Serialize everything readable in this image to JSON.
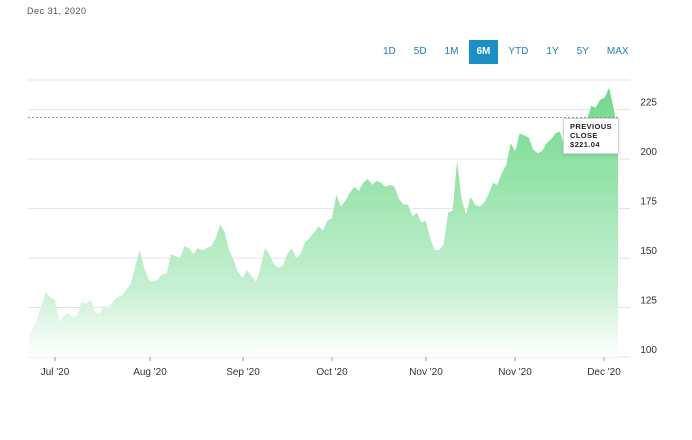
{
  "header": {
    "date": "Dec 31, 2020"
  },
  "range_tabs": [
    {
      "label": "1D",
      "active": false
    },
    {
      "label": "5D",
      "active": false
    },
    {
      "label": "1M",
      "active": false
    },
    {
      "label": "6M",
      "active": true
    },
    {
      "label": "YTD",
      "active": false
    },
    {
      "label": "1Y",
      "active": false
    },
    {
      "label": "5Y",
      "active": false
    },
    {
      "label": "MAX",
      "active": false
    }
  ],
  "tooltip": {
    "line1": "PREVIOUS",
    "line2": "CLOSE",
    "value": "$221.04"
  },
  "colors": {
    "area_top": "#6fd98a",
    "area_bottom": "#ffffff",
    "accent": "#1b8fc3",
    "grid": "#e3e3e3"
  },
  "chart_data": {
    "type": "area",
    "title": "",
    "xlabel": "",
    "ylabel": "",
    "ylim": [
      100,
      240
    ],
    "yticks": [
      100,
      125,
      150,
      175,
      200,
      225
    ],
    "xtick_labels": [
      "Jul '20",
      "Aug '20",
      "Sep '20",
      "Oct '20",
      "Nov '20",
      "Nov '20",
      "Dec '20"
    ],
    "reference_line": {
      "label": "PREVIOUS CLOSE",
      "value": 221.04
    },
    "legend": "none",
    "grid": true,
    "series": [
      {
        "values": [
          108,
          114,
          119,
          126,
          133,
          130,
          129,
          118,
          121,
          122,
          120,
          121,
          128,
          127,
          129,
          123,
          122,
          126,
          125,
          128,
          130,
          131,
          134,
          137,
          146,
          154,
          145,
          139,
          138,
          139,
          142,
          142,
          152,
          151,
          150,
          156,
          155,
          152,
          155,
          154,
          155,
          156,
          160,
          167,
          163,
          154,
          149,
          143,
          140,
          144,
          141,
          138,
          145,
          155,
          152,
          147,
          145,
          146,
          152,
          155,
          150,
          152,
          158,
          160,
          163,
          166,
          164,
          169,
          170,
          182,
          176,
          179,
          183,
          186,
          184,
          188,
          190,
          187,
          189,
          188,
          186,
          187,
          186,
          180,
          177,
          177,
          171,
          173,
          168,
          169,
          160,
          154,
          154,
          157,
          173,
          174,
          199,
          180,
          172,
          181,
          177,
          176,
          178,
          182,
          188,
          187,
          193,
          197,
          208,
          204,
          213,
          212,
          211,
          205,
          203,
          204,
          208,
          210,
          213,
          214,
          206,
          217,
          220,
          218,
          215,
          219,
          227,
          226,
          230,
          231,
          236,
          226,
          214
        ]
      }
    ]
  }
}
